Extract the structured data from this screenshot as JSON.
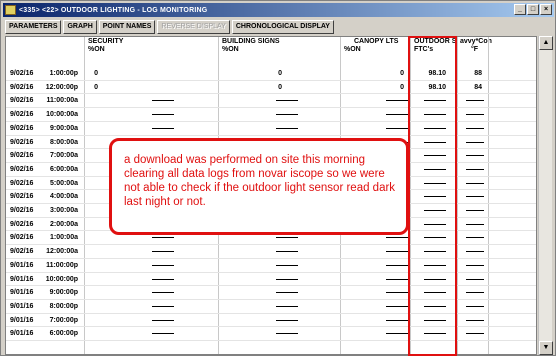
{
  "window": {
    "title": "<335> <22> OUTDOOR LIGHTING - LOG MONITORING",
    "controls": [
      "_",
      "□",
      "×"
    ]
  },
  "toolbar": {
    "buttons": [
      {
        "label": "PARAMETERS",
        "enabled": true
      },
      {
        "label": "GRAPH",
        "enabled": true
      },
      {
        "label": "POINT NAMES",
        "enabled": true
      },
      {
        "label": "REVERSE DISPLAY",
        "enabled": false
      },
      {
        "label": "CHRONOLOGICAL DISPLAY",
        "enabled": true
      }
    ]
  },
  "columns": {
    "security": {
      "name": "SECURITY",
      "unit": "%ON"
    },
    "building_signs": {
      "name": "BUILDING SIGNS",
      "unit": "%ON"
    },
    "canopy_lts": {
      "name": "CANOPY LTS",
      "unit": "%ON"
    },
    "outdoor": {
      "name": "OUTDOOR S",
      "unit": "FTC's"
    },
    "savvy": {
      "name": "avvy*Con",
      "unit": "°F"
    }
  },
  "rows": [
    {
      "date": "9/02/16",
      "time": "1:00:00p",
      "security": "0",
      "building_signs": "0",
      "canopy_lts": "0",
      "outdoor": "98.10",
      "savvy": "88"
    },
    {
      "date": "9/02/16",
      "time": "12:00:00p",
      "security": "0",
      "building_signs": "0",
      "canopy_lts": "0",
      "outdoor": "98.10",
      "savvy": "84"
    },
    {
      "date": "9/02/16",
      "time": "11:00:00a"
    },
    {
      "date": "9/02/16",
      "time": "10:00:00a"
    },
    {
      "date": "9/02/16",
      "time": "9:00:00a"
    },
    {
      "date": "9/02/16",
      "time": "8:00:00a"
    },
    {
      "date": "9/02/16",
      "time": "7:00:00a"
    },
    {
      "date": "9/02/16",
      "time": "6:00:00a"
    },
    {
      "date": "9/02/16",
      "time": "5:00:00a"
    },
    {
      "date": "9/02/16",
      "time": "4:00:00a"
    },
    {
      "date": "9/02/16",
      "time": "3:00:00a"
    },
    {
      "date": "9/02/16",
      "time": "2:00:00a"
    },
    {
      "date": "9/02/16",
      "time": "1:00:00a"
    },
    {
      "date": "9/02/16",
      "time": "12:00:00a"
    },
    {
      "date": "9/01/16",
      "time": "11:00:00p"
    },
    {
      "date": "9/01/16",
      "time": "10:00:00p"
    },
    {
      "date": "9/01/16",
      "time": "9:00:00p"
    },
    {
      "date": "9/01/16",
      "time": "8:00:00p"
    },
    {
      "date": "9/01/16",
      "time": "7:00:00p"
    },
    {
      "date": "9/01/16",
      "time": "6:00:00p"
    }
  ],
  "annotation": {
    "text": "a download was performed on site this morning clearing all data logs from novar iscope so we were not able to check if the outdoor light sensor read dark last night or not.",
    "color": "#e01010"
  },
  "scrollbar": {
    "up": "▲",
    "down": "▼"
  }
}
